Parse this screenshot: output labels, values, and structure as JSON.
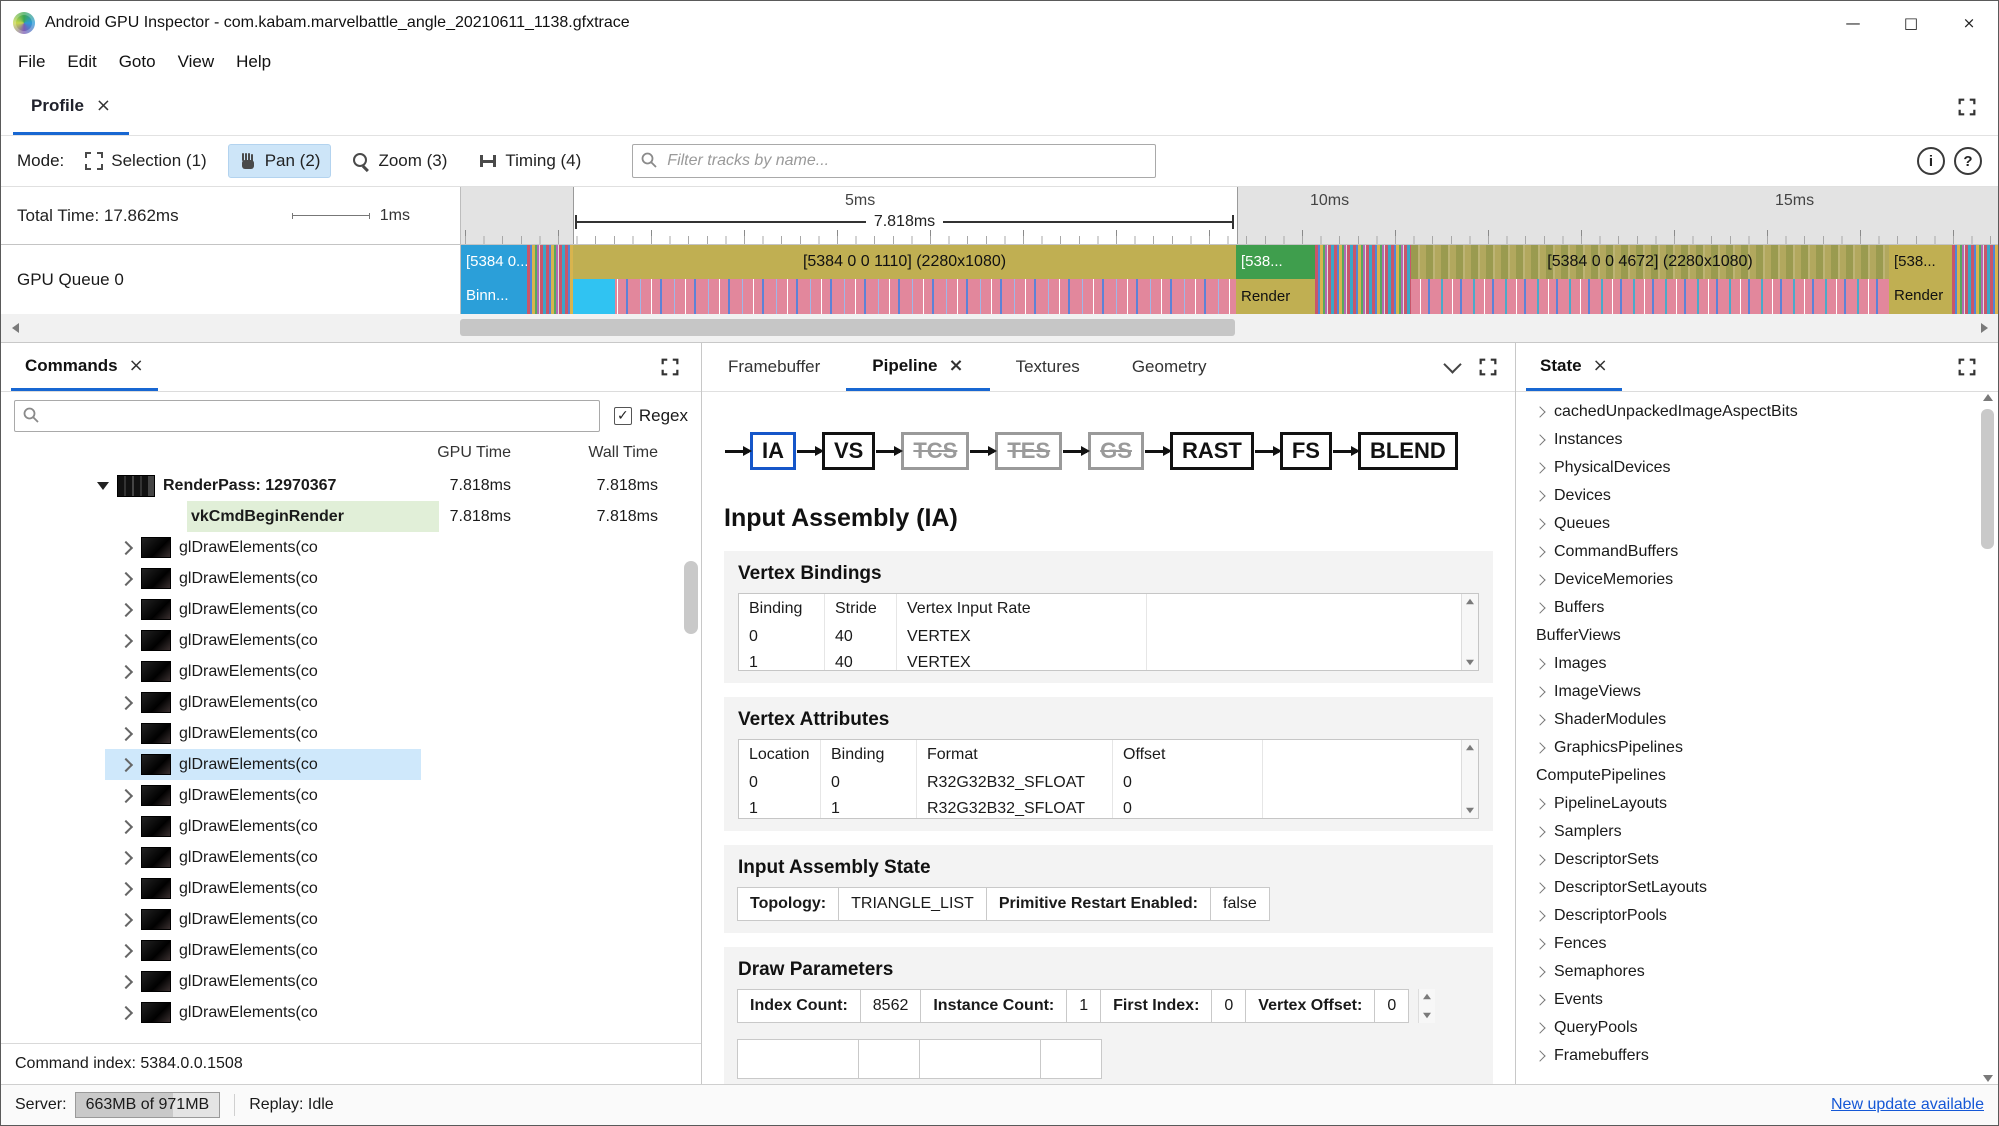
{
  "window": {
    "title": "Android GPU Inspector - com.kabam.marvelbattle_angle_20210611_1138.gfxtrace",
    "minimize": "—",
    "maximize": "□",
    "close": "×"
  },
  "glyphs": {
    "close": "×",
    "check": "✓",
    "info": "i",
    "help": "?"
  },
  "menubar": {
    "items": [
      "File",
      "Edit",
      "Goto",
      "View",
      "Help"
    ]
  },
  "profile_tab": {
    "label": "Profile"
  },
  "toolbar": {
    "mode_label": "Mode:",
    "modes": [
      {
        "label": "Selection (1)",
        "icon": "selection-icon",
        "cls": ""
      },
      {
        "label": "Pan (2)",
        "icon": "pan-icon",
        "cls": "active"
      },
      {
        "label": "Zoom (3)",
        "icon": "zoom-icon",
        "cls": ""
      },
      {
        "label": "Timing (4)",
        "icon": "timing-icon",
        "cls": ""
      }
    ],
    "filter_placeholder": "Filter tracks by name..."
  },
  "timeline": {
    "total_time_label": "Total Time: 17.862ms",
    "scale_label": "1ms",
    "tick_5": "5ms",
    "tick_10": "10ms",
    "tick_15": "15ms",
    "selection_duration": "7.818ms",
    "track_name": "GPU Queue 0",
    "blocks": [
      {
        "label": "[5384 0...",
        "sub": "Binn..."
      },
      {
        "label": "[5384 0 0 1110] (2280x1080)",
        "sub": ""
      },
      {
        "label": "[538...",
        "sub": "Render"
      },
      {
        "label": "[5384 0 0 4672] (2280x1080)",
        "sub": ""
      },
      {
        "label": "[538...",
        "sub": "Render"
      }
    ]
  },
  "commands": {
    "tab_label": "Commands",
    "regex_label": "Regex",
    "col_gpu": "GPU Time",
    "col_wall": "Wall Time",
    "rows": [
      {
        "label": "RenderPass: 12970367",
        "gpu": "7.818ms",
        "wall": "7.818ms",
        "cls": "renderpass",
        "twisty": "open",
        "icon": "strip"
      },
      {
        "label": "vkCmdBeginRender",
        "gpu": "7.818ms",
        "wall": "7.818ms",
        "cls": "begin",
        "twisty": "",
        "icon": ""
      },
      {
        "label": "glDrawElements(co",
        "gpu": "",
        "wall": "",
        "cls": "draw",
        "twisty": "closed",
        "icon": "thumb"
      },
      {
        "label": "glDrawElements(co",
        "gpu": "",
        "wall": "",
        "cls": "draw",
        "twisty": "closed",
        "icon": "thumb"
      },
      {
        "label": "glDrawElements(co",
        "gpu": "",
        "wall": "",
        "cls": "draw",
        "twisty": "closed",
        "icon": "thumb"
      },
      {
        "label": "glDrawElements(co",
        "gpu": "",
        "wall": "",
        "cls": "draw",
        "twisty": "closed",
        "icon": "thumb"
      },
      {
        "label": "glDrawElements(co",
        "gpu": "",
        "wall": "",
        "cls": "draw",
        "twisty": "closed",
        "icon": "thumb"
      },
      {
        "label": "glDrawElements(co",
        "gpu": "",
        "wall": "",
        "cls": "draw",
        "twisty": "closed",
        "icon": "thumb"
      },
      {
        "label": "glDrawElements(co",
        "gpu": "",
        "wall": "",
        "cls": "draw",
        "twisty": "closed",
        "icon": "thumb"
      },
      {
        "label": "glDrawElements(co",
        "gpu": "",
        "wall": "",
        "cls": "draw sel",
        "twisty": "closed",
        "icon": "thumb"
      },
      {
        "label": "glDrawElements(co",
        "gpu": "",
        "wall": "",
        "cls": "draw",
        "twisty": "closed",
        "icon": "thumb"
      },
      {
        "label": "glDrawElements(co",
        "gpu": "",
        "wall": "",
        "cls": "draw",
        "twisty": "closed",
        "icon": "thumb"
      },
      {
        "label": "glDrawElements(co",
        "gpu": "",
        "wall": "",
        "cls": "draw",
        "twisty": "closed",
        "icon": "thumb"
      },
      {
        "label": "glDrawElements(co",
        "gpu": "",
        "wall": "",
        "cls": "draw",
        "twisty": "closed",
        "icon": "thumb"
      },
      {
        "label": "glDrawElements(co",
        "gpu": "",
        "wall": "",
        "cls": "draw",
        "twisty": "closed",
        "icon": "thumb"
      },
      {
        "label": "glDrawElements(co",
        "gpu": "",
        "wall": "",
        "cls": "draw",
        "twisty": "closed",
        "icon": "thumb"
      },
      {
        "label": "glDrawElements(co",
        "gpu": "",
        "wall": "",
        "cls": "draw",
        "twisty": "closed",
        "icon": "thumb"
      },
      {
        "label": "glDrawElements(co",
        "gpu": "",
        "wall": "",
        "cls": "draw",
        "twisty": "closed",
        "icon": "thumb"
      }
    ],
    "footer": "Command index: 5384.0.0.1508"
  },
  "pipeline": {
    "tabs": [
      {
        "label": "Framebuffer",
        "cls": "",
        "closable": false
      },
      {
        "label": "Pipeline",
        "cls": "active",
        "closable": true
      },
      {
        "label": "Textures",
        "cls": "",
        "closable": false
      },
      {
        "label": "Geometry",
        "cls": "",
        "closable": false
      }
    ],
    "stages": [
      {
        "label": "IA",
        "cls": "sel"
      },
      {
        "label": "VS",
        "cls": "on"
      },
      {
        "label": "TCS",
        "cls": "off"
      },
      {
        "label": "TES",
        "cls": "off"
      },
      {
        "label": "GS",
        "cls": "off"
      },
      {
        "label": "RAST",
        "cls": "on"
      },
      {
        "label": "FS",
        "cls": "on"
      },
      {
        "label": "BLEND",
        "cls": "on"
      }
    ],
    "heading": "Input Assembly (IA)",
    "vertex_bindings": {
      "title": "Vertex Bindings",
      "columns": [
        "Binding",
        "Stride",
        "Vertex Input Rate"
      ],
      "rows": [
        [
          "0",
          "40",
          "VERTEX"
        ],
        [
          "1",
          "40",
          "VERTEX"
        ]
      ]
    },
    "vertex_attributes": {
      "title": "Vertex Attributes",
      "columns": [
        "Location",
        "Binding",
        "Format",
        "Offset"
      ],
      "rows": [
        [
          "0",
          "0",
          "R32G32B32_SFLOAT",
          "0"
        ],
        [
          "1",
          "1",
          "R32G32B32_SFLOAT",
          "0"
        ]
      ]
    },
    "input_assembly_state": {
      "title": "Input Assembly State",
      "fields": [
        {
          "label": "Topology:",
          "value": "TRIANGLE_LIST"
        },
        {
          "label": "Primitive Restart Enabled:",
          "value": "false"
        }
      ]
    },
    "draw_parameters": {
      "title": "Draw Parameters",
      "fields": [
        {
          "label": "Index Count:",
          "value": "8562"
        },
        {
          "label": "Instance Count:",
          "value": "1"
        },
        {
          "label": "First Index:",
          "value": "0"
        },
        {
          "label": "Vertex Offset:",
          "value": "0"
        }
      ]
    }
  },
  "state_panel": {
    "tab_label": "State",
    "items": [
      {
        "label": "cachedUnpackedImageAspectBits",
        "chevron": true
      },
      {
        "label": "Instances",
        "chevron": true
      },
      {
        "label": "PhysicalDevices",
        "chevron": true
      },
      {
        "label": "Devices",
        "chevron": true
      },
      {
        "label": "Queues",
        "chevron": true
      },
      {
        "label": "CommandBuffers",
        "chevron": true
      },
      {
        "label": "DeviceMemories",
        "chevron": true
      },
      {
        "label": "Buffers",
        "chevron": true
      },
      {
        "label": "BufferViews",
        "chevron": false
      },
      {
        "label": "Images",
        "chevron": true
      },
      {
        "label": "ImageViews",
        "chevron": true
      },
      {
        "label": "ShaderModules",
        "chevron": true
      },
      {
        "label": "GraphicsPipelines",
        "chevron": true
      },
      {
        "label": "ComputePipelines",
        "chevron": false
      },
      {
        "label": "PipelineLayouts",
        "chevron": true
      },
      {
        "label": "Samplers",
        "chevron": true
      },
      {
        "label": "DescriptorSets",
        "chevron": true
      },
      {
        "label": "DescriptorSetLayouts",
        "chevron": true
      },
      {
        "label": "DescriptorPools",
        "chevron": true
      },
      {
        "label": "Fences",
        "chevron": true
      },
      {
        "label": "Semaphores",
        "chevron": true
      },
      {
        "label": "Events",
        "chevron": true
      },
      {
        "label": "QueryPools",
        "chevron": true
      },
      {
        "label": "Framebuffers",
        "chevron": true
      }
    ]
  },
  "status_bar": {
    "server_label": "Server:",
    "server_value": "663MB of 971MB",
    "replay_label": "Replay: Idle",
    "update_link": "New update available"
  }
}
